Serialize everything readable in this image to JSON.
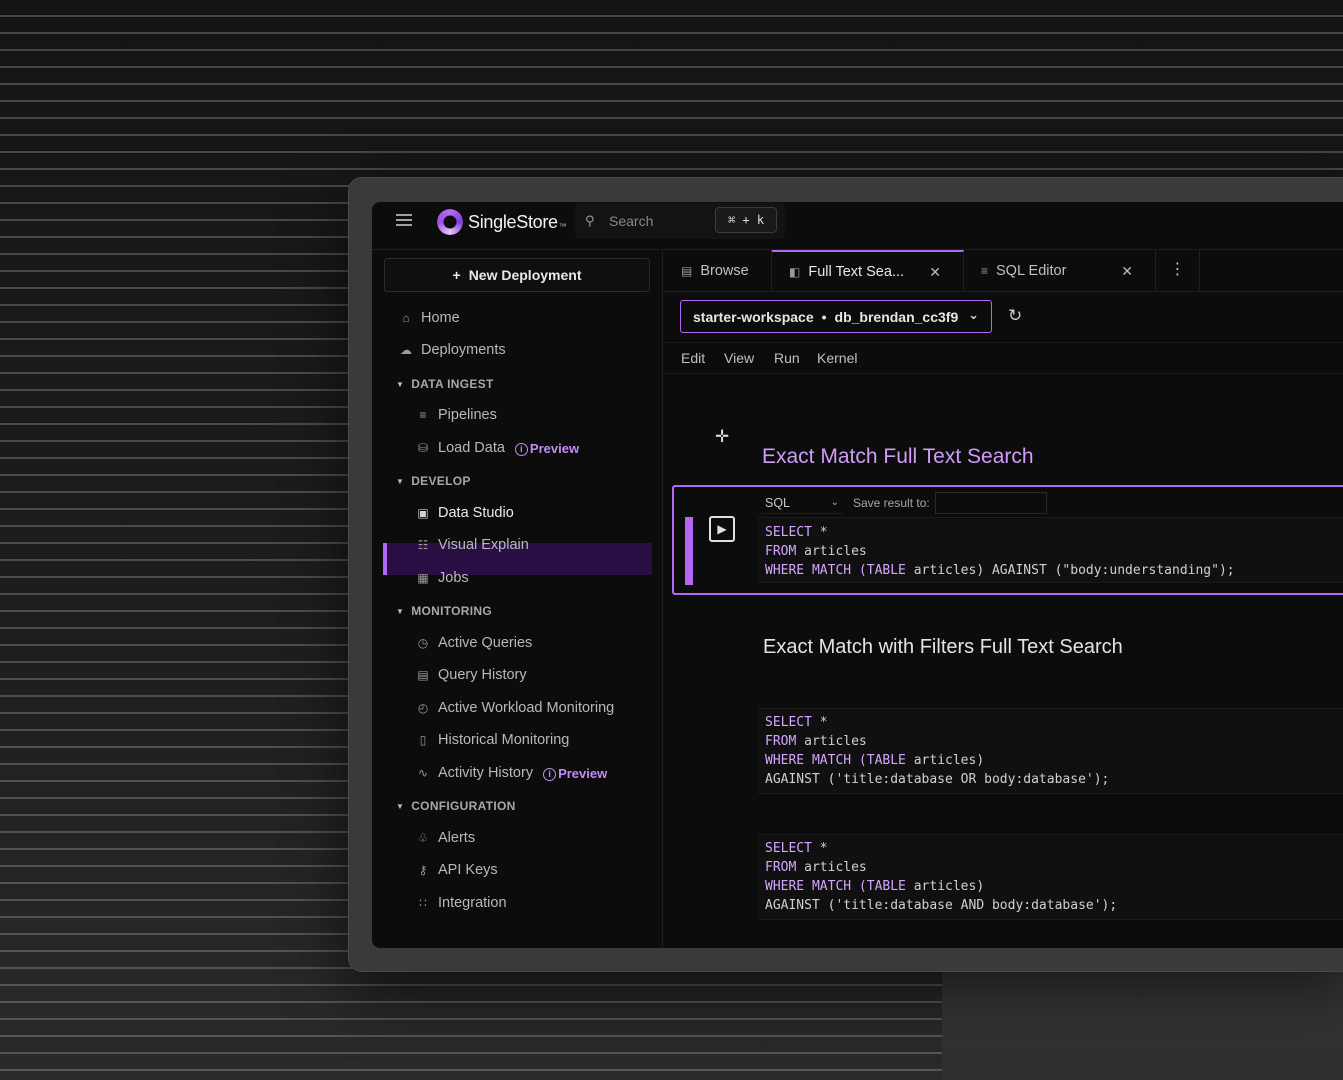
{
  "header": {
    "brand": "SingleStore",
    "brand_tm": "™",
    "search_placeholder": "Search",
    "shortcut": "⌘ + k"
  },
  "sidebar": {
    "new_deployment": "New Deployment",
    "home": "Home",
    "deployments": "Deployments",
    "sections": {
      "data_ingest": "DATA INGEST",
      "develop": "DEVELOP",
      "monitoring": "MONITORING",
      "configuration": "CONFIGURATION"
    },
    "items": {
      "pipelines": "Pipelines",
      "load_data": "Load Data",
      "data_studio": "Data Studio",
      "visual_explain": "Visual Explain",
      "jobs": "Jobs",
      "active_queries": "Active Queries",
      "query_history": "Query History",
      "active_workload_monitoring": "Active Workload Monitoring",
      "historical_monitoring": "Historical Monitoring",
      "activity_history": "Activity History",
      "alerts": "Alerts",
      "api_keys": "API Keys",
      "integration": "Integration"
    },
    "preview_badge": "Preview"
  },
  "tabs": {
    "browse": "Browse",
    "full_text_search": "Full Text Sea...",
    "sql_editor": "SQL Editor"
  },
  "workspace": {
    "name": "starter-workspace",
    "separator": "•",
    "database": "db_brendan_cc3f9"
  },
  "menu": {
    "edit": "Edit",
    "view": "View",
    "run": "Run",
    "kernel": "Kernel"
  },
  "notebook": {
    "title_1": "Exact Match Full Text Search",
    "title_2": "Exact Match with Filters Full Text Search",
    "cell_language": "SQL",
    "save_result_label": "Save result to:",
    "cell1": {
      "l1_kw": "SELECT",
      "l1_rest": " *",
      "l2_kw": "FROM",
      "l2_rest": " articles",
      "l3_kw": "WHERE MATCH (TABLE",
      "l3_rest": " articles) AGAINST (\"body:understanding\");"
    },
    "cell2": {
      "l1_kw": "SELECT",
      "l1_rest": " *",
      "l2_kw": "FROM",
      "l2_rest": " articles",
      "l3_kw": "WHERE MATCH (TABLE",
      "l3_rest": " articles)",
      "l4": "AGAINST ('title:database OR body:database');"
    },
    "cell3": {
      "l1_kw": "SELECT",
      "l1_rest": " *",
      "l2_kw": "FROM",
      "l2_rest": " articles",
      "l3_kw": "WHERE MATCH (TABLE",
      "l3_rest": " articles)",
      "l4": "AGAINST ('title:database AND body:database');"
    }
  },
  "colors": {
    "accent": "#b268f2",
    "active_bg": "#2a0f45",
    "heading_accent": "#cf9cf8"
  }
}
